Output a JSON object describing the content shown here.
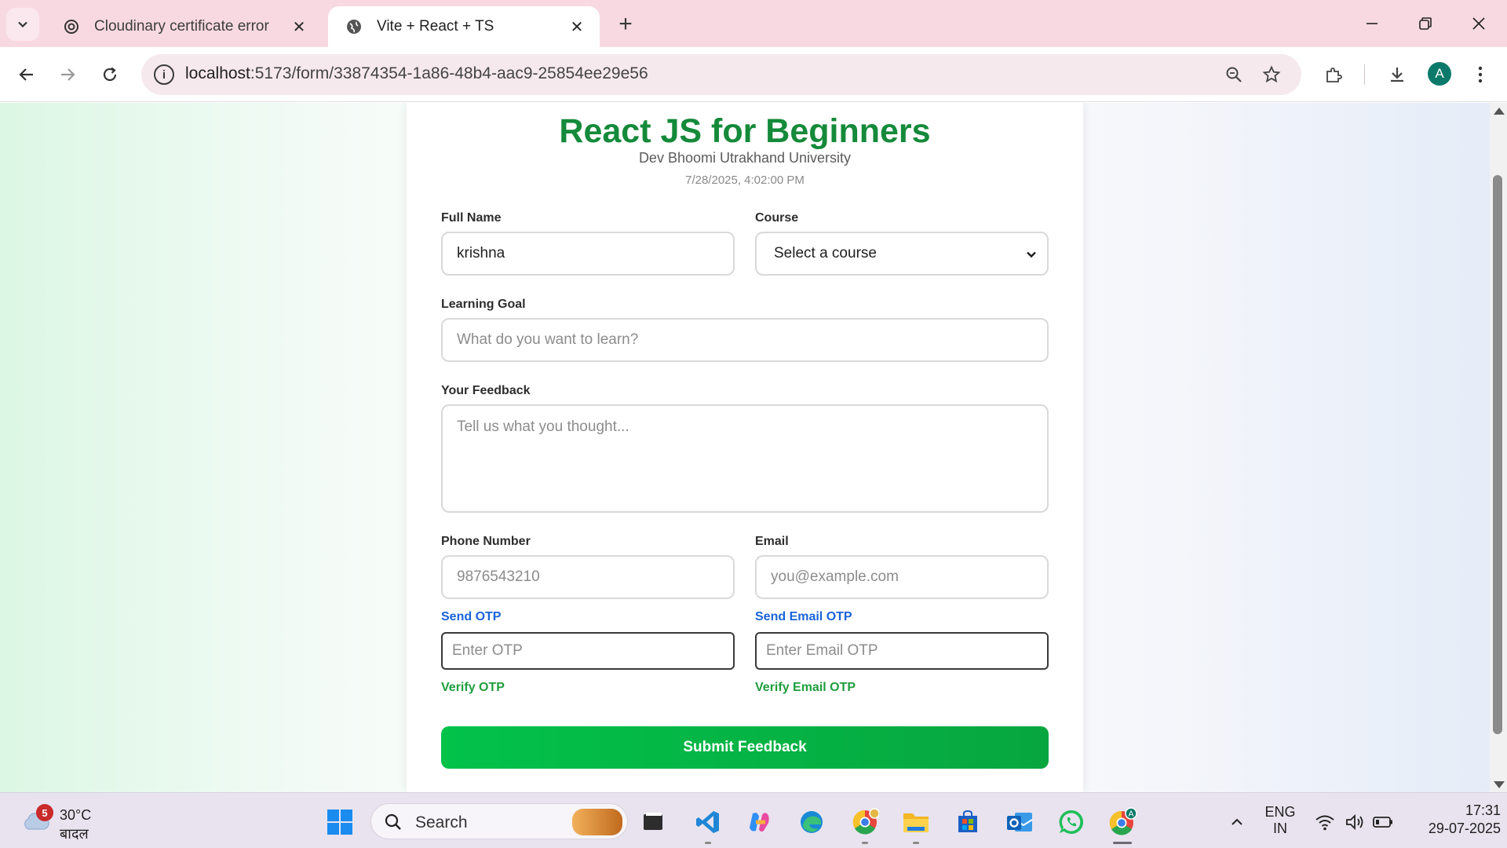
{
  "browser": {
    "tabs": [
      {
        "title": "Cloudinary certificate error",
        "active": false
      },
      {
        "title": "Vite + React + TS",
        "active": true
      }
    ],
    "address": {
      "host": "localhost",
      "path": ":5173/form/33874354-1a86-48b4-aac9-25854ee29e56"
    },
    "profile_initial": "A"
  },
  "form": {
    "title": "React JS for Beginners",
    "subtitle": "Dev Bhoomi Utrakhand University",
    "timestamp": "7/28/2025, 4:02:00 PM",
    "full_name": {
      "label": "Full Name",
      "value": "krishna"
    },
    "course": {
      "label": "Course",
      "selected": "Select a course"
    },
    "learning_goal": {
      "label": "Learning Goal",
      "placeholder": "What do you want to learn?"
    },
    "feedback": {
      "label": "Your Feedback",
      "placeholder": "Tell us what you thought..."
    },
    "phone": {
      "label": "Phone Number",
      "placeholder": "9876543210",
      "send_otp": "Send OTP",
      "otp_placeholder": "Enter OTP",
      "verify": "Verify OTP"
    },
    "email": {
      "label": "Email",
      "placeholder": "you@example.com",
      "send_otp": "Send Email OTP",
      "otp_placeholder": "Enter Email OTP",
      "verify": "Verify Email OTP"
    },
    "submit_label": "Submit Feedback"
  },
  "taskbar": {
    "weather": {
      "badge": "5",
      "temp": "30°C",
      "condition": "बादल"
    },
    "search_label": "Search",
    "language": {
      "line1": "ENG",
      "line2": "IN"
    },
    "clock": {
      "time": "17:31",
      "date": "29-07-2025"
    }
  },
  "colors": {
    "title_green": "#148a3a",
    "link_blue": "#1a63d8",
    "link_green": "#1f9e3d",
    "submit_green": "#02c24a"
  }
}
